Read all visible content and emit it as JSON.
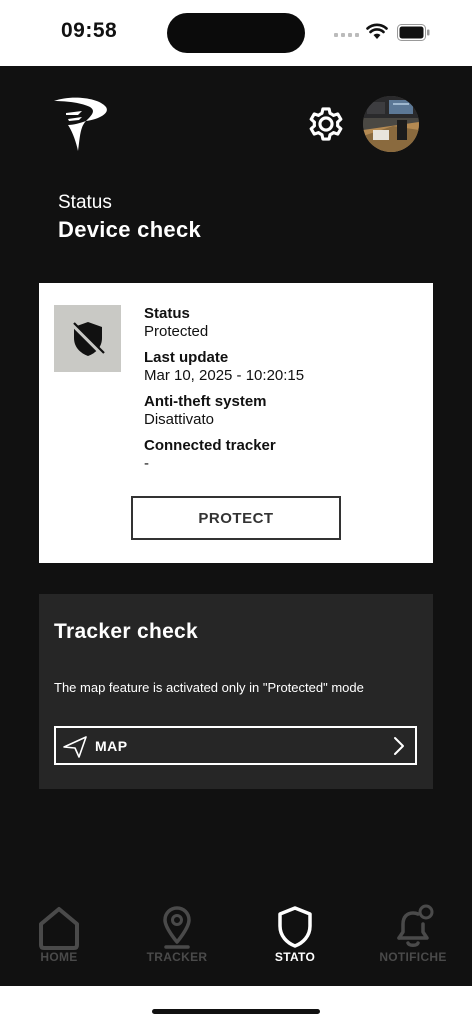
{
  "status_bar": {
    "time": "09:58"
  },
  "header": {
    "subtitle": "Status",
    "title": "Device check"
  },
  "device_card": {
    "status_label": "Status",
    "status_value": "Protected",
    "last_update_label": "Last update",
    "last_update_value": "Mar 10, 2025 - 10:20:15",
    "antitheft_label": "Anti-theft system",
    "antitheft_value": "Disattivato",
    "tracker_label": "Connected tracker",
    "tracker_value": "-",
    "protect_button": "PROTECT"
  },
  "tracker_card": {
    "title": "Tracker check",
    "description": "The map feature is activated only in \"Protected\" mode",
    "map_button": "MAP"
  },
  "tabbar": {
    "items": [
      {
        "label": "HOME",
        "icon": "home-icon",
        "active": false
      },
      {
        "label": "TRACKER",
        "icon": "location-pin-icon",
        "active": false
      },
      {
        "label": "STATO",
        "icon": "shield-icon",
        "active": true
      },
      {
        "label": "NOTIFICHE",
        "icon": "bell-icon",
        "active": false
      }
    ]
  },
  "colors": {
    "background": "#111111",
    "card_light": "#ffffff",
    "card_dark": "#262626",
    "inactive_tab": "#4a4a4a",
    "active_tab": "#ffffff"
  }
}
